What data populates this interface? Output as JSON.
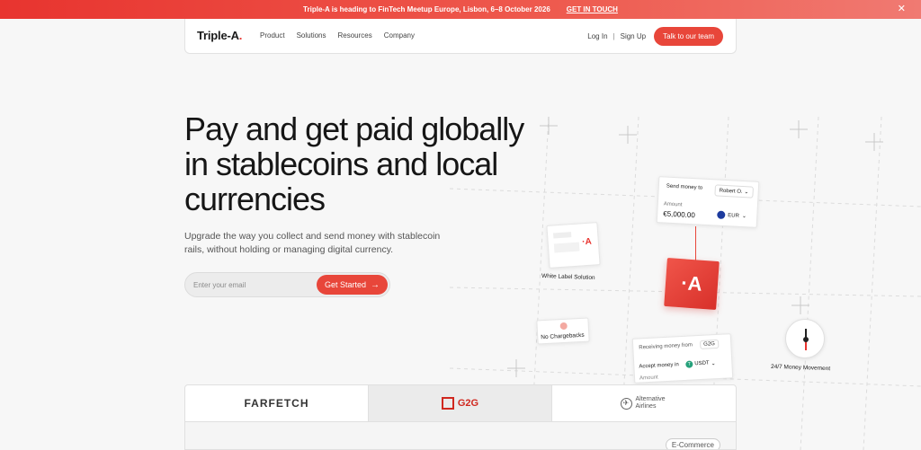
{
  "banner": {
    "message": "Triple-A is heading to FinTech Meetup Europe, Lisbon, 6–8 October 2026",
    "cta": "GET IN TOUCH",
    "close_icon": "close-icon"
  },
  "nav": {
    "logo_text": "Triple-A",
    "logo_dot": ".",
    "links": [
      "Product",
      "Solutions",
      "Resources",
      "Company"
    ],
    "login": "Log In",
    "separator": "|",
    "signup": "Sign Up",
    "cta": "Talk to our team"
  },
  "hero": {
    "title": "Pay and get paid globally in stablecoins and local currencies",
    "subtitle": "Upgrade the way you collect and send money with stablecoin rails, without holding or managing digital currency.",
    "email_placeholder": "Enter your email",
    "cta": "Get Started",
    "cta_icon": "arrow-right-icon"
  },
  "illustration": {
    "send_card": {
      "label": "Send money to",
      "recipient": "Robert O.",
      "amount_label": "Amount",
      "amount": "€5,000.00",
      "currency": "EUR"
    },
    "center_logo": "·A",
    "white_label": {
      "mini_logo": "·A",
      "caption": "White Label Solution"
    },
    "no_chargebacks": "No Chargebacks",
    "receive_card": {
      "label": "Receiving money from",
      "sender": "G2G",
      "accept_label": "Accept money in",
      "coin_symbol": "T",
      "currency": "USDT",
      "amount_label": "Amount"
    },
    "clock_caption": "24/7 Money Movement"
  },
  "logos": {
    "items": [
      "FARFETCH",
      "G2G",
      "Alternative Airlines"
    ],
    "active_index": 1,
    "tag": "E-Commerce"
  },
  "colors": {
    "accent": "#e8463a",
    "banner_start": "#e8342f",
    "banner_end": "#f07a72"
  }
}
